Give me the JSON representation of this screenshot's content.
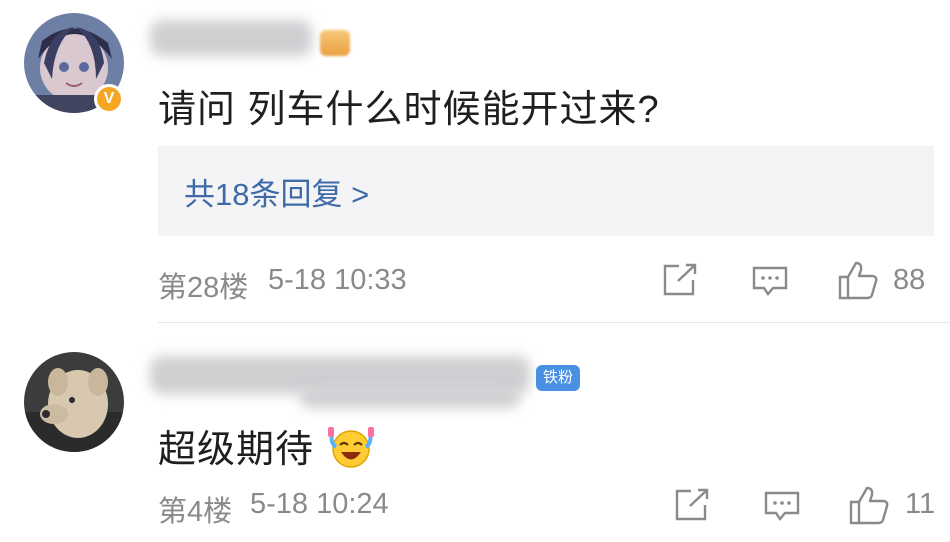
{
  "comments": [
    {
      "text": "请问 列车什么时候能开过来?",
      "reply_link": "共18条回复 >",
      "floor": "第28楼",
      "time": "5-18 10:33",
      "likes": "88",
      "verified_icon": "v-badge-icon"
    },
    {
      "text": "超级期待",
      "badge": "铁粉",
      "emoji": "laughing-crying-emoji",
      "floor": "第4楼",
      "time": "5-18 10:24",
      "likes": "11"
    }
  ],
  "colors": {
    "link": "#3f6aa8",
    "meta": "#8a8a8a",
    "reply_bg": "#f4f4f6",
    "fan_badge": "#4a90e2",
    "verified": "#f5a623"
  }
}
